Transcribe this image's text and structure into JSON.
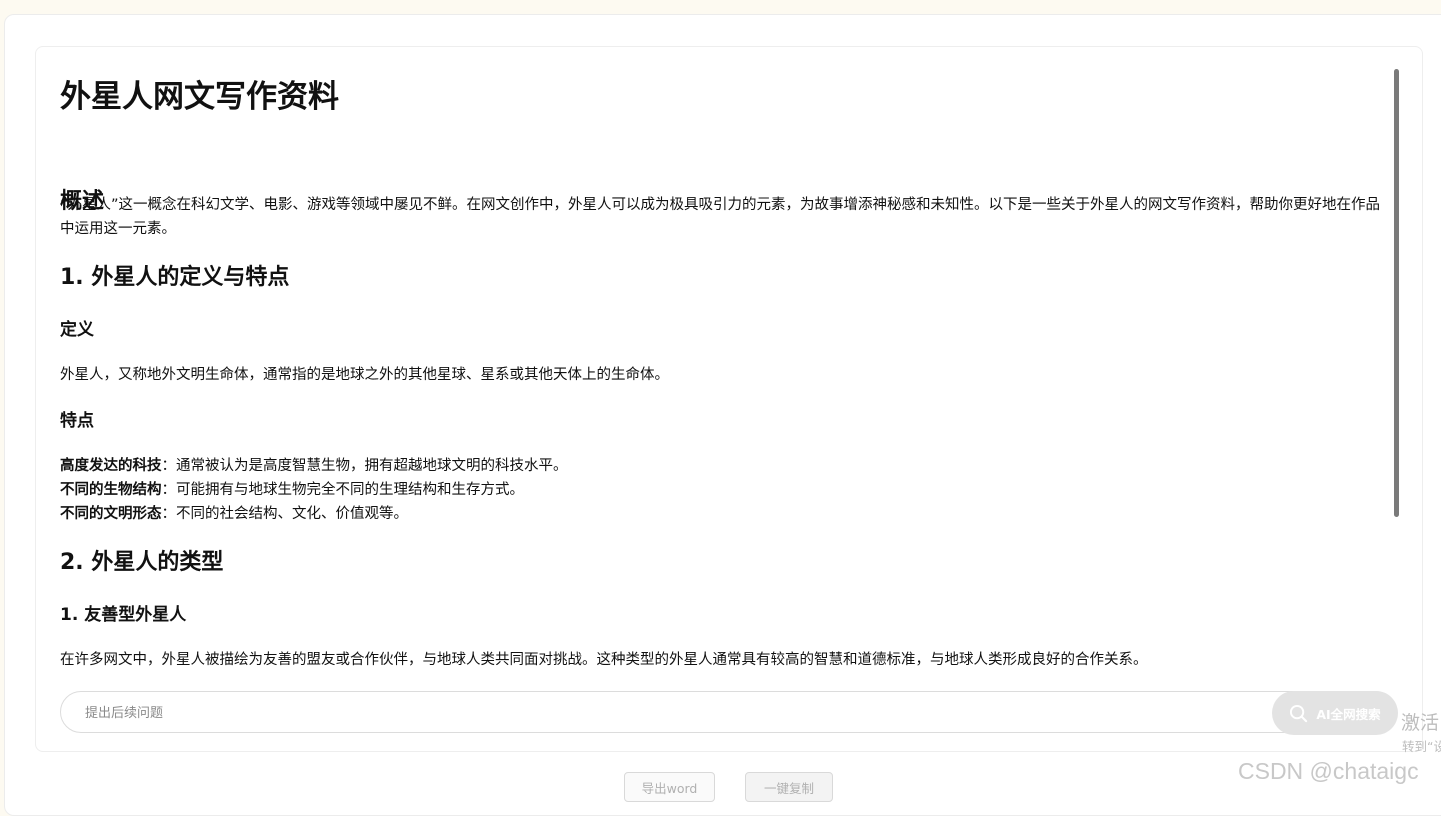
{
  "document": {
    "title": "外星人网文写作资料",
    "overview_heading": "概述",
    "overview_text": "“外星人”这一概念在科幻文学、电影、游戏等领域中屡见不鲜。在网文创作中，外星人可以成为极具吸引力的元素，为故事增添神秘感和未知性。以下是一些关于外星人的网文写作资料，帮助你更好地在作品中运用这一元素。",
    "section1_heading": "1. 外星人的定义与特点",
    "definition_heading": "定义",
    "definition_text": "外星人，又称地外文明生命体，通常指的是地球之外的其他星球、星系或其他天体上的生命体。",
    "traits_heading": "特点",
    "traits": [
      {
        "label": "高度发达的科技",
        "text": "：通常被认为是高度智慧生物，拥有超越地球文明的科技水平。"
      },
      {
        "label": "不同的生物结构",
        "text": "：可能拥有与地球生物完全不同的生理结构和生存方式。"
      },
      {
        "label": "不同的文明形态",
        "text": "：不同的社会结构、文化、价值观等。"
      }
    ],
    "section2_heading": "2. 外星人的类型",
    "type1_heading": "1. 友善型外星人",
    "type1_text": "在许多网文中，外星人被描绘为友善的盟友或合作伙伴，与地球人类共同面对挑战。这种类型的外星人通常具有较高的智慧和道德标准，与地球人类形成良好的合作关系。"
  },
  "prompt": {
    "placeholder": "提出后续问题"
  },
  "ai_search": {
    "label": "AI全网搜索",
    "icon": "search-icon"
  },
  "footer": {
    "export_label": "导出word",
    "copy_label": "一键复制"
  },
  "overlay": {
    "activate_text": "激活",
    "activate_sub": "转到“设",
    "watermark": "CSDN @chataigc"
  },
  "colors": {
    "text": "#111111",
    "ai_button_bg": "#e3e3e3",
    "scroll_thumb": "#7a7a7a"
  }
}
